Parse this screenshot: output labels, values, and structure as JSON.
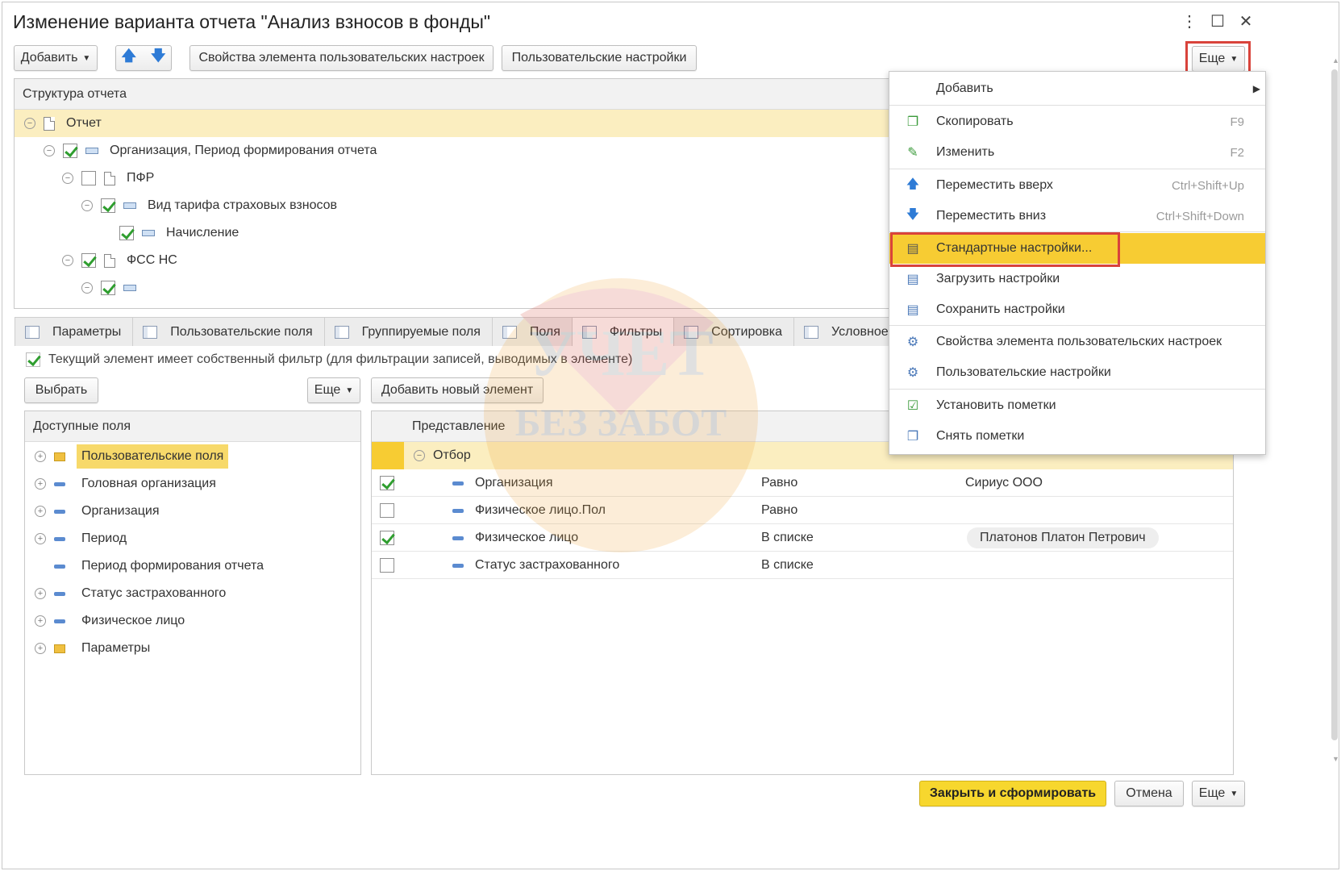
{
  "window": {
    "title": "Изменение варианта отчета \"Анализ взносов в фонды\"",
    "controls": [
      "more-vertical-icon",
      "maximize-icon",
      "close-icon"
    ]
  },
  "toolbar": {
    "add_label": "Добавить",
    "move_up_icon": "arrow-up-icon",
    "move_down_icon": "arrow-down-icon",
    "element_props_label": "Свойства элемента пользовательских настроек",
    "user_settings_label": "Пользовательские настройки",
    "more_label": "Еще"
  },
  "structure": {
    "header": "Структура отчета",
    "rows": [
      {
        "label": "Отчет",
        "selected": true
      },
      {
        "label": "Организация, Период формирования отчета",
        "checked": true
      },
      {
        "label": "ПФР",
        "checked": false
      },
      {
        "label": "Вид тарифа страховых взносов",
        "checked": true
      },
      {
        "label": "Начисление",
        "checked": true
      },
      {
        "label": "ФСС НС",
        "checked": true
      },
      {
        "label": "",
        "checked": true
      }
    ]
  },
  "tabs": [
    {
      "label": "Параметры"
    },
    {
      "label": "Пользовательские поля"
    },
    {
      "label": "Группируемые поля"
    },
    {
      "label": "Поля"
    },
    {
      "label": "Фильтры",
      "active": true
    },
    {
      "label": "Сортировка"
    },
    {
      "label": "Условное оф"
    }
  ],
  "filter": {
    "own_filter_label": "Текущий элемент имеет собственный фильтр (для фильтрации записей, выводимых в элементе)",
    "own_filter_checked": true,
    "select_label": "Выбрать",
    "more_label": "Еще",
    "add_new_label": "Добавить новый элемент",
    "available_header": "Доступные поля",
    "available": [
      {
        "label": "Пользовательские поля",
        "type": "folder",
        "expandable": true,
        "selected": true
      },
      {
        "label": "Головная организация",
        "type": "field",
        "expandable": true
      },
      {
        "label": "Организация",
        "type": "field",
        "expandable": true
      },
      {
        "label": "Период",
        "type": "field",
        "expandable": true
      },
      {
        "label": "Период формирования отчета",
        "type": "field",
        "expandable": false
      },
      {
        "label": "Статус застрахованного",
        "type": "field",
        "expandable": true
      },
      {
        "label": "Физическое лицо",
        "type": "field",
        "expandable": true
      },
      {
        "label": "Параметры",
        "type": "folder",
        "expandable": true
      }
    ],
    "grid_header": "Представление",
    "group_label": "Отбор",
    "rows": [
      {
        "checked": true,
        "field": "Организация",
        "condition": "Равно",
        "value": "Сириус ООО",
        "pill": false
      },
      {
        "checked": false,
        "field": "Физическое лицо.Пол",
        "condition": "Равно",
        "value": "",
        "pill": false
      },
      {
        "checked": true,
        "field": "Физическое лицо",
        "condition": "В списке",
        "value": "Платонов Платон Петрович",
        "pill": true
      },
      {
        "checked": false,
        "field": "Статус застрахованного",
        "condition": "В списке",
        "value": "",
        "pill": false
      }
    ]
  },
  "menu": {
    "items": [
      {
        "label": "Добавить",
        "key": "",
        "icon": "",
        "submenu": true
      },
      {
        "label": "Скопировать",
        "key": "F9",
        "icon": "copy-icon"
      },
      {
        "label": "Изменить",
        "key": "F2",
        "icon": "pencil-icon"
      },
      {
        "label": "Переместить вверх",
        "key": "Ctrl+Shift+Up",
        "icon": "arrow-up-icon"
      },
      {
        "label": "Переместить вниз",
        "key": "Ctrl+Shift+Down",
        "icon": "arrow-down-icon"
      },
      {
        "label": "Стандартные настройки...",
        "key": "",
        "icon": "standard-settings-icon",
        "highlighted": true
      },
      {
        "label": "Загрузить настройки",
        "key": "",
        "icon": "load-settings-icon"
      },
      {
        "label": "Сохранить настройки",
        "key": "",
        "icon": "save-settings-icon"
      },
      {
        "label": "Свойства элемента пользовательских настроек",
        "key": "",
        "icon": "element-props-icon"
      },
      {
        "label": "Пользовательские настройки",
        "key": "",
        "icon": "user-settings-icon"
      },
      {
        "label": "Установить пометки",
        "key": "",
        "icon": "check-all-icon"
      },
      {
        "label": "Снять пометки",
        "key": "",
        "icon": "uncheck-all-icon"
      }
    ]
  },
  "footer": {
    "close_and_run_label": "Закрыть и сформировать",
    "cancel_label": "Отмена",
    "more_label": "Еще"
  },
  "watermark": {
    "line1": "УЧЕТ",
    "line2": "БЕЗ ЗАБОТ"
  },
  "colors": {
    "accent_yellow": "#f7cc33",
    "selection_yellow": "#fbeec0",
    "highlight_red": "#d9433b",
    "check_green": "#2f9e2f",
    "arrow_blue": "#2e7bd6"
  }
}
